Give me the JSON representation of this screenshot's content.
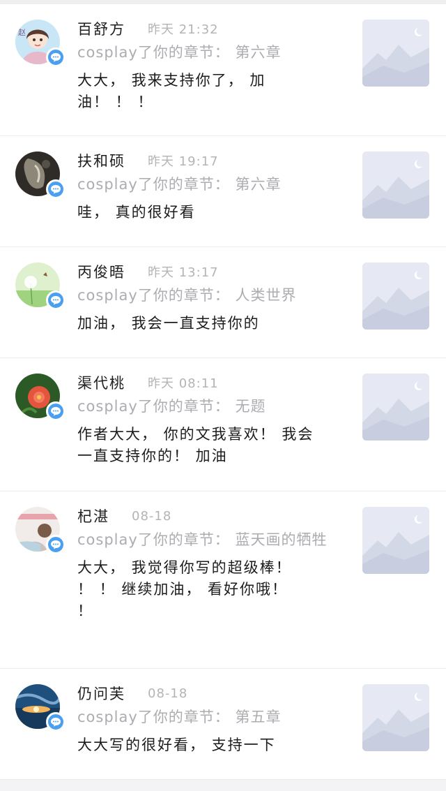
{
  "comments": [
    {
      "name": "百舒方",
      "time": "昨天 21:32",
      "ref": "cosplay了你的章节： 第六章",
      "text": "大大， 我来支持你了， 加油！ ！ ！",
      "avatar_icon": "girl-cartoon-avatar",
      "avatar_colors": [
        "#bfe1f4",
        "#e9c7d3"
      ]
    },
    {
      "name": "扶和硕",
      "time": "昨天 19:17",
      "ref": "cosplay了你的章节： 第六章",
      "text": "哇， 真的很好看",
      "avatar_icon": "dark-photo-avatar",
      "avatar_colors": [
        "#3a3530",
        "#8a8479"
      ]
    },
    {
      "name": "丙俊晤",
      "time": "昨天 13:17",
      "ref": "cosplay了你的章节： 人类世界",
      "text": "加油， 我会一直支持你的",
      "avatar_icon": "dandelion-avatar",
      "avatar_colors": [
        "#a7d98a",
        "#e8f5d8"
      ]
    },
    {
      "name": "渠代桃",
      "time": "昨天 08:11",
      "ref": "cosplay了你的章节： 无题",
      "text": "作者大大， 你的文我喜欢！ 我会一直支持你的！ 加油",
      "avatar_icon": "red-flower-avatar",
      "avatar_colors": [
        "#2f6b2a",
        "#e2513b"
      ]
    },
    {
      "name": "杞湛",
      "time": "08-18",
      "ref": "cosplay了你的章节： 蓝天画的牺牲",
      "text": "大大， 我觉得你写的超级棒！ ！ ！ 继续加油， 看好你哦！ ！",
      "avatar_icon": "person-photo-avatar",
      "avatar_colors": [
        "#f0ecea",
        "#e9a6ae"
      ]
    },
    {
      "name": "仍问芙",
      "time": "08-18",
      "ref": "cosplay了你的章节： 第五章",
      "text": "大大写的很好看， 支持一下",
      "avatar_icon": "sunset-sky-avatar",
      "avatar_colors": [
        "#1d4d7a",
        "#f0b25a"
      ]
    }
  ],
  "badge_icon": "chat-bubble-icon",
  "badge_color": "#4a9ff0",
  "thumbnail_icon": "image-placeholder-icon"
}
